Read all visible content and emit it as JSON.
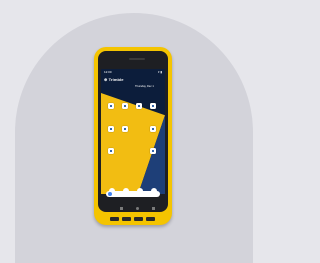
{
  "scene": {
    "background_color": "#e6e6eb",
    "arch_color": "#d3d3da",
    "device_color": "#f4c400"
  },
  "phone": {
    "status_time": "12:00",
    "status_icons": "▾ ▮",
    "brand": "⊕ Trimble",
    "date": "Thursday, Dec 1",
    "icons": [
      "app-icon",
      "phone-icon",
      "search-icon",
      "google-icon"
    ]
  }
}
